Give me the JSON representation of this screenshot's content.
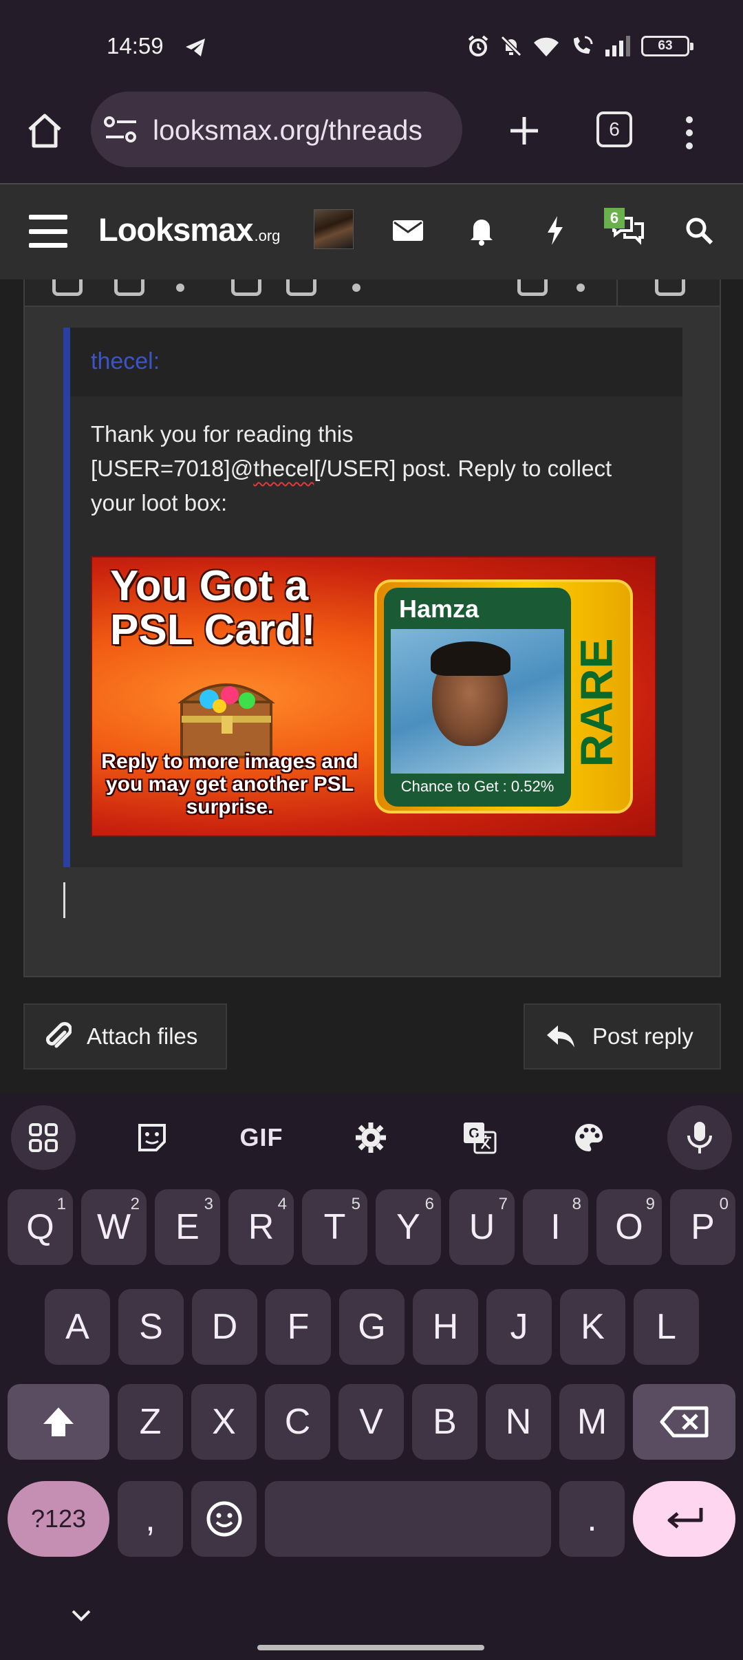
{
  "status_bar": {
    "time": "14:59",
    "battery": "63"
  },
  "browser": {
    "url": "looksmax.org/threads",
    "tab_count": "6"
  },
  "site_header": {
    "logo_main": "Looksmax",
    "logo_suffix": ".org",
    "chat_badge_count": "6"
  },
  "quote": {
    "author": "thecel:",
    "body_before": "Thank you for reading this [USER=7018]@",
    "body_misspelled": "thecel",
    "body_after": "[/USER] post. Reply to collect your loot box:"
  },
  "promo_image": {
    "title_line1": "You Got a",
    "title_line2": "PSL Card!",
    "subtitle": "Reply to more images and you may get another PSL surprise.",
    "card_name": "Hamza",
    "card_chance": "Chance to Get : 0.52%",
    "card_rarity": "RARE"
  },
  "actions": {
    "attach_label": "Attach files",
    "reply_label": "Post reply"
  },
  "keyboard": {
    "toolbar": [
      "apps-icon",
      "sticker-icon",
      "GIF",
      "settings-icon",
      "translate-icon",
      "palette-icon",
      "mic-icon"
    ],
    "gif_label": "GIF",
    "row1": [
      {
        "key": "Q",
        "alt": "1"
      },
      {
        "key": "W",
        "alt": "2"
      },
      {
        "key": "E",
        "alt": "3"
      },
      {
        "key": "R",
        "alt": "4"
      },
      {
        "key": "T",
        "alt": "5"
      },
      {
        "key": "Y",
        "alt": "6"
      },
      {
        "key": "U",
        "alt": "7"
      },
      {
        "key": "I",
        "alt": "8"
      },
      {
        "key": "O",
        "alt": "9"
      },
      {
        "key": "P",
        "alt": "0"
      }
    ],
    "row2": [
      "A",
      "S",
      "D",
      "F",
      "G",
      "H",
      "J",
      "K",
      "L"
    ],
    "row3": [
      "Z",
      "X",
      "C",
      "V",
      "B",
      "N",
      "M"
    ],
    "symbols_label": "?123",
    "comma": ",",
    "period": "."
  },
  "colors": {
    "accent_quote_bar": "#2b3fa0",
    "quote_author": "#3a55c8",
    "chat_badge": "#6ab04c",
    "enter_key": "#ffd6ef",
    "symbols_key": "#c48fb2"
  }
}
